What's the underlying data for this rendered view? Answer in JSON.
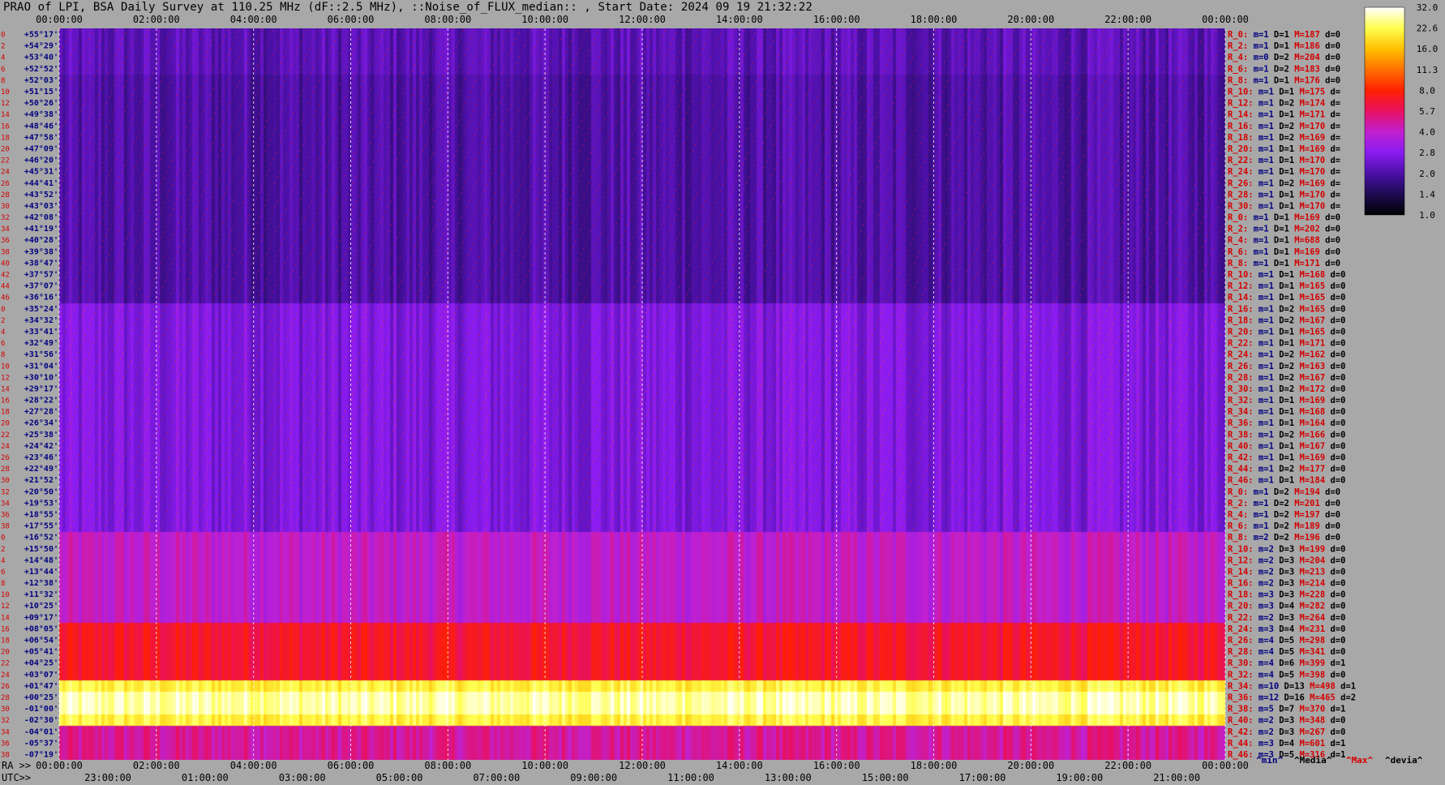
{
  "title": "PRAO of LPI, BSA Daily Survey at 110.25 MHz (dF::2.5 MHz), ::Noise_of_FLUX_median:: , Start Date: 2024 09 19 21:32:22",
  "chart_data": {
    "type": "heatmap",
    "title": "PRAO of LPI, BSA Daily Survey at 110.25 MHz (dF::2.5 MHz), ::Noise_of_FLUX_median:: , Start Date: 2024 09 19 21:32:22",
    "x_top_ticks": [
      "00:00:00",
      "02:00:00",
      "04:00:00",
      "06:00:00",
      "08:00:00",
      "10:00:00",
      "12:00:00",
      "14:00:00",
      "16:00:00",
      "18:00:00",
      "20:00:00",
      "22:00:00",
      "00:00:00"
    ],
    "x_bottom_ra_prefix": "RA >>",
    "x_bottom_ra_ticks": [
      "00:00:00",
      "02:00:00",
      "04:00:00",
      "06:00:00",
      "08:00:00",
      "10:00:00",
      "12:00:00",
      "14:00:00",
      "16:00:00",
      "18:00:00",
      "20:00:00",
      "22:00:00",
      "00:00:00"
    ],
    "x_bottom_utc_prefix": "UTC>>",
    "x_bottom_utc_ticks": [
      "23:00:00",
      "01:00:00",
      "03:00:00",
      "05:00:00",
      "07:00:00",
      "09:00:00",
      "11:00:00",
      "13:00:00",
      "15:00:00",
      "17:00:00",
      "19:00:00",
      "21:00:00"
    ],
    "rows": [
      {
        "idx": "0",
        "dec": "+55°17'"
      },
      {
        "idx": "2",
        "dec": "+54°29'"
      },
      {
        "idx": "4",
        "dec": "+53°40'"
      },
      {
        "idx": "6",
        "dec": "+52°52'"
      },
      {
        "idx": "8",
        "dec": "+52°03'"
      },
      {
        "idx": "10",
        "dec": "+51°15'"
      },
      {
        "idx": "12",
        "dec": "+50°26'"
      },
      {
        "idx": "14",
        "dec": "+49°38'"
      },
      {
        "idx": "16",
        "dec": "+48°46'"
      },
      {
        "idx": "18",
        "dec": "+47°58'"
      },
      {
        "idx": "20",
        "dec": "+47°09'"
      },
      {
        "idx": "22",
        "dec": "+46°20'"
      },
      {
        "idx": "24",
        "dec": "+45°31'"
      },
      {
        "idx": "26",
        "dec": "+44°41'"
      },
      {
        "idx": "28",
        "dec": "+43°52'"
      },
      {
        "idx": "30",
        "dec": "+43°03'"
      },
      {
        "idx": "32",
        "dec": "+42°08'"
      },
      {
        "idx": "34",
        "dec": "+41°19'"
      },
      {
        "idx": "36",
        "dec": "+40°28'"
      },
      {
        "idx": "38",
        "dec": "+39°38'"
      },
      {
        "idx": "40",
        "dec": "+38°47'"
      },
      {
        "idx": "42",
        "dec": "+37°57'"
      },
      {
        "idx": "44",
        "dec": "+37°07'"
      },
      {
        "idx": "46",
        "dec": "+36°16'"
      },
      {
        "idx": "0",
        "dec": "+35°24'"
      },
      {
        "idx": "2",
        "dec": "+34°32'"
      },
      {
        "idx": "4",
        "dec": "+33°41'"
      },
      {
        "idx": "6",
        "dec": "+32°49'"
      },
      {
        "idx": "8",
        "dec": "+31°56'"
      },
      {
        "idx": "10",
        "dec": "+31°04'"
      },
      {
        "idx": "12",
        "dec": "+30°10'"
      },
      {
        "idx": "14",
        "dec": "+29°17'"
      },
      {
        "idx": "16",
        "dec": "+28°22'"
      },
      {
        "idx": "18",
        "dec": "+27°28'"
      },
      {
        "idx": "20",
        "dec": "+26°34'"
      },
      {
        "idx": "22",
        "dec": "+25°38'"
      },
      {
        "idx": "24",
        "dec": "+24°42'"
      },
      {
        "idx": "26",
        "dec": "+23°46'"
      },
      {
        "idx": "28",
        "dec": "+22°49'"
      },
      {
        "idx": "30",
        "dec": "+21°52'"
      },
      {
        "idx": "32",
        "dec": "+20°50'"
      },
      {
        "idx": "34",
        "dec": "+19°53'"
      },
      {
        "idx": "36",
        "dec": "+18°55'"
      },
      {
        "idx": "38",
        "dec": "+17°55'"
      },
      {
        "idx": "0",
        "dec": "+16°52'"
      },
      {
        "idx": "2",
        "dec": "+15°50'"
      },
      {
        "idx": "4",
        "dec": "+14°48'"
      },
      {
        "idx": "6",
        "dec": "+13°44'"
      },
      {
        "idx": "8",
        "dec": "+12°38'"
      },
      {
        "idx": "10",
        "dec": "+11°32'"
      },
      {
        "idx": "12",
        "dec": "+10°25'"
      },
      {
        "idx": "14",
        "dec": "+09°17'"
      },
      {
        "idx": "16",
        "dec": "+08°05'"
      },
      {
        "idx": "18",
        "dec": "+06°54'"
      },
      {
        "idx": "20",
        "dec": "+05°41'"
      },
      {
        "idx": "22",
        "dec": "+04°25'"
      },
      {
        "idx": "24",
        "dec": "+03°07'"
      },
      {
        "idx": "26",
        "dec": "+01°47'"
      },
      {
        "idx": "28",
        "dec": "+00°25'"
      },
      {
        "idx": "30",
        "dec": "-01°00'"
      },
      {
        "idx": "32",
        "dec": "-02°30'"
      },
      {
        "idx": "34",
        "dec": "-04°01'"
      },
      {
        "idx": "36",
        "dec": "-05°37'"
      },
      {
        "idx": "38",
        "dec": "-07°19'"
      }
    ],
    "stats": [
      {
        "r": "R_0:",
        "m": "1",
        "D": "1",
        "M": "187",
        "d": "0"
      },
      {
        "r": "R_2:",
        "m": "1",
        "D": "1",
        "M": "186",
        "d": "0"
      },
      {
        "r": "R_4:",
        "m": "0",
        "D": "2",
        "M": "204",
        "d": "0"
      },
      {
        "r": "R_6:",
        "m": "1",
        "D": "2",
        "M": "183",
        "d": "0"
      },
      {
        "r": "R_8:",
        "m": "1",
        "D": "1",
        "M": "176",
        "d": "0"
      },
      {
        "r": "R_10:",
        "m": "1",
        "D": "1",
        "M": "175",
        "d": ""
      },
      {
        "r": "R_12:",
        "m": "1",
        "D": "2",
        "M": "174",
        "d": ""
      },
      {
        "r": "R_14:",
        "m": "1",
        "D": "1",
        "M": "171",
        "d": ""
      },
      {
        "r": "R_16:",
        "m": "1",
        "D": "2",
        "M": "170",
        "d": ""
      },
      {
        "r": "R_18:",
        "m": "1",
        "D": "2",
        "M": "169",
        "d": ""
      },
      {
        "r": "R_20:",
        "m": "1",
        "D": "1",
        "M": "169",
        "d": ""
      },
      {
        "r": "R_22:",
        "m": "1",
        "D": "1",
        "M": "170",
        "d": ""
      },
      {
        "r": "R_24:",
        "m": "1",
        "D": "1",
        "M": "170",
        "d": ""
      },
      {
        "r": "R_26:",
        "m": "1",
        "D": "2",
        "M": "169",
        "d": ""
      },
      {
        "r": "R_28:",
        "m": "1",
        "D": "1",
        "M": "170",
        "d": ""
      },
      {
        "r": "R_30:",
        "m": "1",
        "D": "1",
        "M": "170",
        "d": ""
      },
      {
        "r": "R_0:",
        "m": "1",
        "D": "1",
        "M": "169",
        "d": "0"
      },
      {
        "r": "R_2:",
        "m": "1",
        "D": "1",
        "M": "202",
        "d": "0"
      },
      {
        "r": "R_4:",
        "m": "1",
        "D": "1",
        "M": "688",
        "d": "0"
      },
      {
        "r": "R_6:",
        "m": "1",
        "D": "1",
        "M": "169",
        "d": "0"
      },
      {
        "r": "R_8:",
        "m": "1",
        "D": "1",
        "M": "171",
        "d": "0"
      },
      {
        "r": "R_10:",
        "m": "1",
        "D": "1",
        "M": "168",
        "d": "0"
      },
      {
        "r": "R_12:",
        "m": "1",
        "D": "1",
        "M": "165",
        "d": "0"
      },
      {
        "r": "R_14:",
        "m": "1",
        "D": "1",
        "M": "165",
        "d": "0"
      },
      {
        "r": "R_16:",
        "m": "1",
        "D": "2",
        "M": "165",
        "d": "0"
      },
      {
        "r": "R_18:",
        "m": "1",
        "D": "2",
        "M": "167",
        "d": "0"
      },
      {
        "r": "R_20:",
        "m": "1",
        "D": "1",
        "M": "165",
        "d": "0"
      },
      {
        "r": "R_22:",
        "m": "1",
        "D": "1",
        "M": "171",
        "d": "0"
      },
      {
        "r": "R_24:",
        "m": "1",
        "D": "2",
        "M": "162",
        "d": "0"
      },
      {
        "r": "R_26:",
        "m": "1",
        "D": "2",
        "M": "163",
        "d": "0"
      },
      {
        "r": "R_28:",
        "m": "1",
        "D": "2",
        "M": "167",
        "d": "0"
      },
      {
        "r": "R_30:",
        "m": "1",
        "D": "2",
        "M": "172",
        "d": "0"
      },
      {
        "r": "R_32:",
        "m": "1",
        "D": "1",
        "M": "169",
        "d": "0"
      },
      {
        "r": "R_34:",
        "m": "1",
        "D": "1",
        "M": "168",
        "d": "0"
      },
      {
        "r": "R_36:",
        "m": "1",
        "D": "1",
        "M": "164",
        "d": "0"
      },
      {
        "r": "R_38:",
        "m": "1",
        "D": "2",
        "M": "166",
        "d": "0"
      },
      {
        "r": "R_40:",
        "m": "1",
        "D": "1",
        "M": "167",
        "d": "0"
      },
      {
        "r": "R_42:",
        "m": "1",
        "D": "1",
        "M": "169",
        "d": "0"
      },
      {
        "r": "R_44:",
        "m": "1",
        "D": "2",
        "M": "177",
        "d": "0"
      },
      {
        "r": "R_46:",
        "m": "1",
        "D": "1",
        "M": "184",
        "d": "0"
      },
      {
        "r": "R_0:",
        "m": "1",
        "D": "2",
        "M": "194",
        "d": "0"
      },
      {
        "r": "R_2:",
        "m": "1",
        "D": "2",
        "M": "201",
        "d": "0"
      },
      {
        "r": "R_4:",
        "m": "1",
        "D": "2",
        "M": "197",
        "d": "0"
      },
      {
        "r": "R_6:",
        "m": "1",
        "D": "2",
        "M": "189",
        "d": "0"
      },
      {
        "r": "R_8:",
        "m": "2",
        "D": "2",
        "M": "196",
        "d": "0"
      },
      {
        "r": "R_10:",
        "m": "2",
        "D": "3",
        "M": "199",
        "d": "0"
      },
      {
        "r": "R_12:",
        "m": "2",
        "D": "3",
        "M": "204",
        "d": "0"
      },
      {
        "r": "R_14:",
        "m": "2",
        "D": "3",
        "M": "213",
        "d": "0"
      },
      {
        "r": "R_16:",
        "m": "2",
        "D": "3",
        "M": "214",
        "d": "0"
      },
      {
        "r": "R_18:",
        "m": "3",
        "D": "3",
        "M": "228",
        "d": "0"
      },
      {
        "r": "R_20:",
        "m": "3",
        "D": "4",
        "M": "282",
        "d": "0"
      },
      {
        "r": "R_22:",
        "m": "2",
        "D": "3",
        "M": "264",
        "d": "0"
      },
      {
        "r": "R_24:",
        "m": "3",
        "D": "4",
        "M": "231",
        "d": "0"
      },
      {
        "r": "R_26:",
        "m": "4",
        "D": "5",
        "M": "298",
        "d": "0"
      },
      {
        "r": "R_28:",
        "m": "4",
        "D": "5",
        "M": "341",
        "d": "0"
      },
      {
        "r": "R_30:",
        "m": "4",
        "D": "6",
        "M": "399",
        "d": "1"
      },
      {
        "r": "R_32:",
        "m": "4",
        "D": "5",
        "M": "398",
        "d": "0"
      },
      {
        "r": "R_34:",
        "m": "10",
        "D": "13",
        "M": "498",
        "d": "1"
      },
      {
        "r": "R_36:",
        "m": "12",
        "D": "16",
        "M": "465",
        "d": "2"
      },
      {
        "r": "R_38:",
        "m": "5",
        "D": "7",
        "M": "370",
        "d": "1"
      },
      {
        "r": "R_40:",
        "m": "2",
        "D": "3",
        "M": "348",
        "d": "0"
      },
      {
        "r": "R_42:",
        "m": "2",
        "D": "3",
        "M": "267",
        "d": "0"
      },
      {
        "r": "R_44:",
        "m": "3",
        "D": "4",
        "M": "601",
        "d": "1"
      },
      {
        "r": "R_46:",
        "m": "3",
        "D": "5",
        "M": "316",
        "d": "1"
      }
    ],
    "stats_footer": [
      "^min^",
      "^Media^",
      "^Max^",
      "^devia^"
    ],
    "colorbar": {
      "ticks": [
        "32.0",
        "22.6",
        "16.0",
        "11.3",
        "8.0",
        "5.7",
        "4.0",
        "2.8",
        "2.0",
        "1.4",
        "1.0"
      ],
      "scale": "log2",
      "range": [
        1.0,
        32.0
      ]
    },
    "colors": {
      "background": "#a8a8a8",
      "label_red": "#d40000",
      "label_blue": "#000080",
      "palette": [
        "#000000",
        "#1c0b50",
        "#4c10a8",
        "#8a1cf0",
        "#c020d0",
        "#e81060",
        "#ff2000",
        "#ff7000",
        "#ffc000",
        "#ffff50",
        "#ffffff"
      ]
    }
  }
}
